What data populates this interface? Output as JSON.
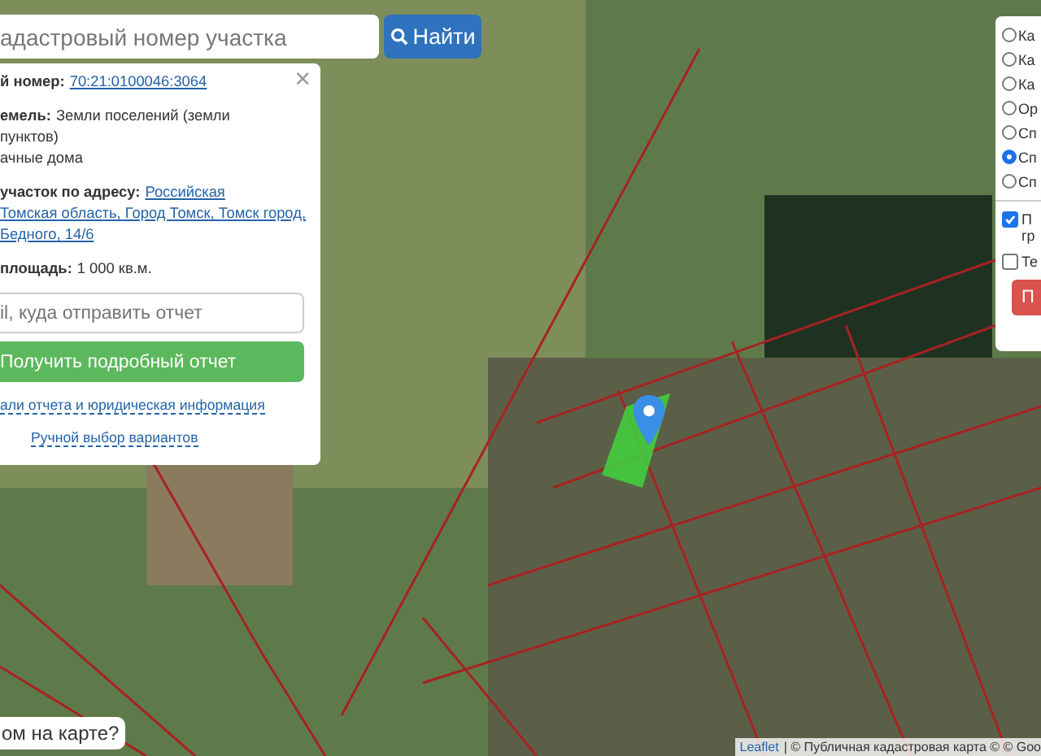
{
  "search": {
    "placeholder": "адастровый номер участка",
    "button": "Найти"
  },
  "info_panel": {
    "close": "×",
    "rows": [
      {
        "label": "й номер:",
        "link_lines": [
          "70:21:0100046:3064"
        ],
        "lines": []
      },
      {
        "label": "емель:",
        "lines": [
          "Земли поселений (земли",
          "пунктов)",
          "ачные дома"
        ],
        "link_lines": []
      },
      {
        "label": " участок по адресу:",
        "link_lines": [
          "Российская",
          "Томская область, Город Томск, Томск город,",
          "Бедного, 14/6"
        ],
        "lines": []
      },
      {
        "label": "площадь:",
        "lines": [
          "1 000 кв.м."
        ],
        "link_lines": []
      }
    ],
    "email_placeholder": "il, куда отправить отчет",
    "report_button": "Получить подробный отчет",
    "links": [
      "али отчета и юридическая информация",
      "Ручной выбор вариантов"
    ]
  },
  "layers_panel": {
    "radios": [
      {
        "label": "Ка",
        "selected": false
      },
      {
        "label": "Ка",
        "selected": false
      },
      {
        "label": "Ка",
        "selected": false
      },
      {
        "label": "Ор",
        "selected": false
      },
      {
        "label": "Сп",
        "selected": false
      },
      {
        "label": "Сп",
        "selected": true
      },
      {
        "label": "Сп",
        "selected": false
      }
    ],
    "checkboxes": [
      {
        "lines": [
          "П",
          "гр"
        ],
        "checked": true
      },
      {
        "lines": [
          "Те"
        ],
        "checked": false
      }
    ],
    "button": "П"
  },
  "help_tooltip": "ом на карте?",
  "attribution": {
    "link": "Leaflet",
    "text": "| © Публичная кадастровая карта © © Goo"
  }
}
